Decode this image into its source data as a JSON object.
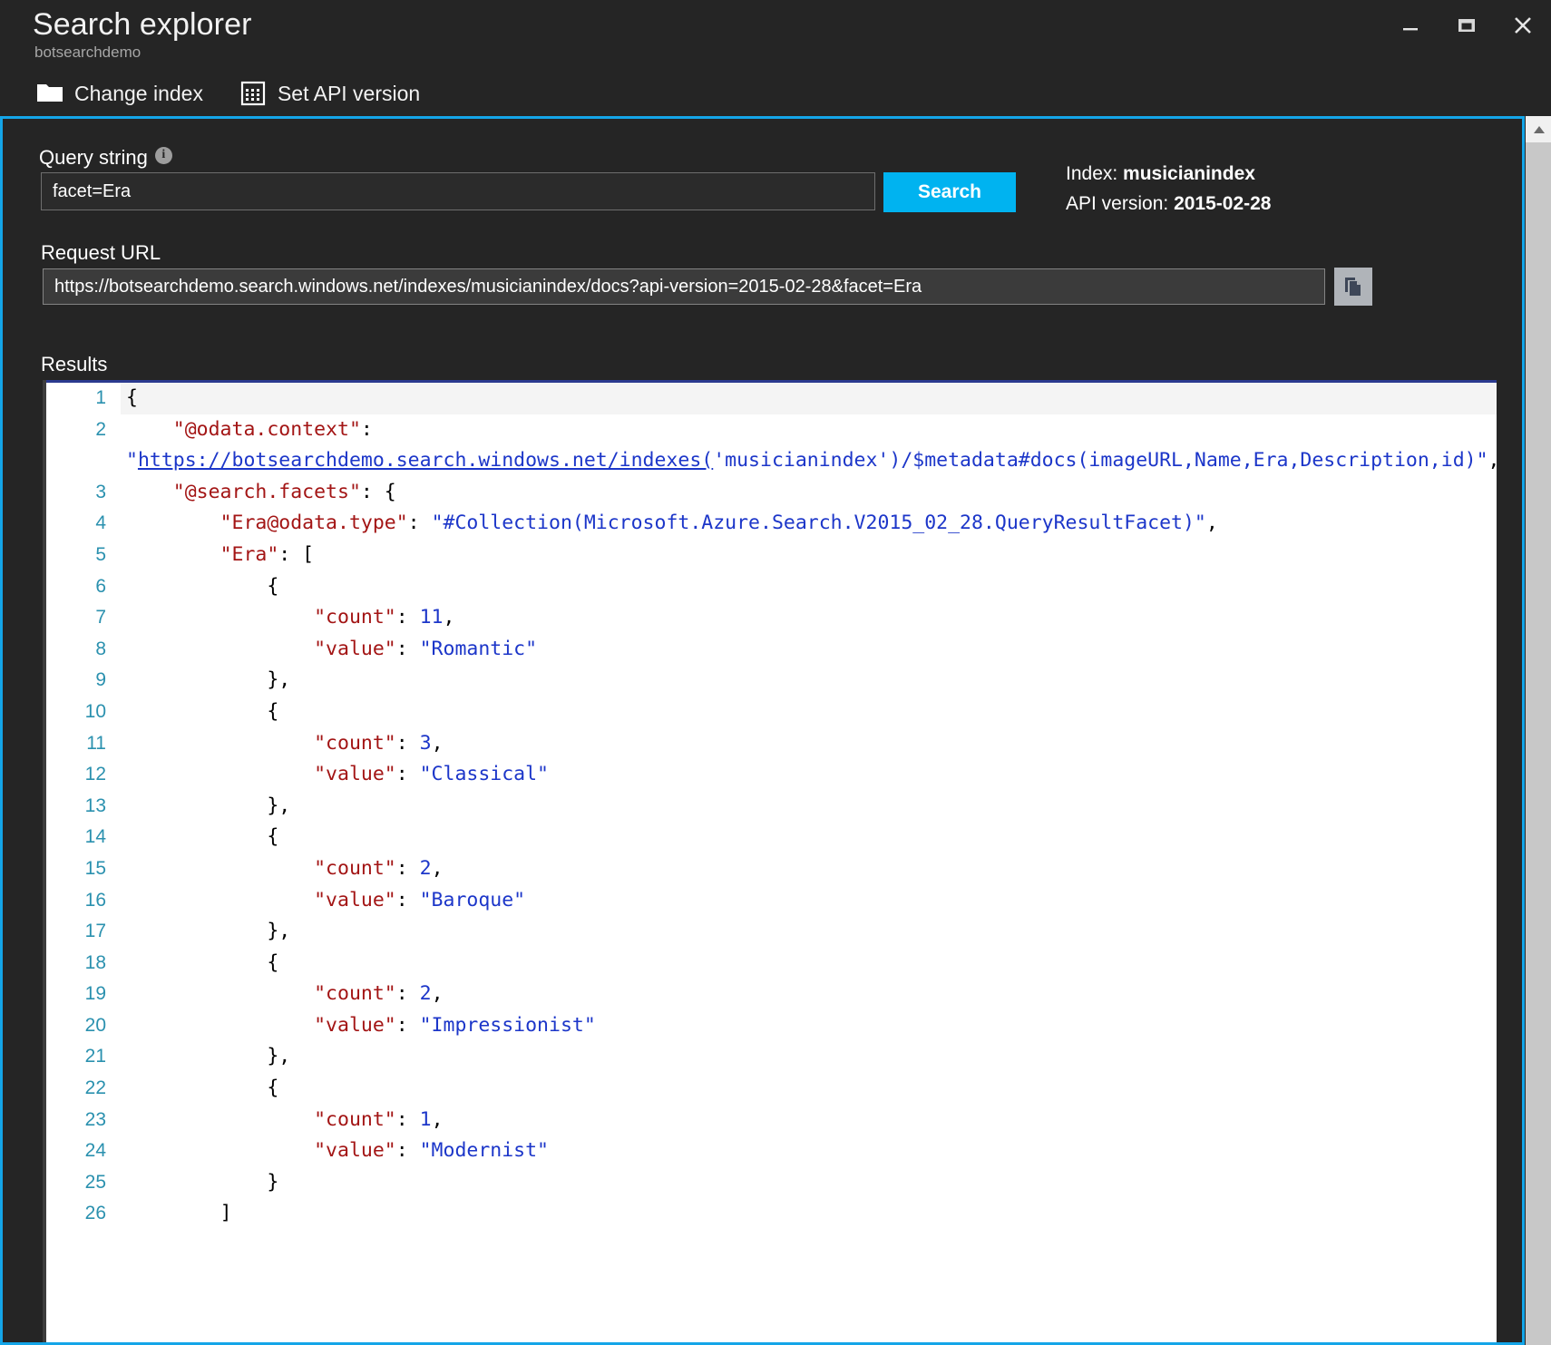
{
  "window": {
    "title": "Search explorer",
    "subtitle": "botsearchdemo",
    "controls": {
      "minimize": "Minimize",
      "maximize": "Maximize",
      "close": "Close"
    }
  },
  "commandbar": {
    "items": [
      {
        "label": "Change index",
        "icon": "folder-icon"
      },
      {
        "label": "Set API version",
        "icon": "grid-calendar-icon"
      }
    ]
  },
  "query": {
    "label": "Query string",
    "info_icon": "info-icon",
    "value": "facet=Era",
    "placeholder": "",
    "search_label": "Search"
  },
  "index_info": {
    "index_label": "Index: ",
    "index_value": "musicianindex",
    "api_label": "API version: ",
    "api_value": "2015-02-28"
  },
  "request": {
    "label": "Request URL",
    "url": "https://botsearchdemo.search.windows.net/indexes/musicianindex/docs?api-version=2015-02-28&facet=Era",
    "copy_icon": "copy-icon"
  },
  "results": {
    "label": "Results",
    "lines": [
      {
        "n": "1",
        "segments": [
          {
            "t": "{",
            "c": "p"
          }
        ]
      },
      {
        "n": "2",
        "segments": [
          {
            "t": "    ",
            "c": "p"
          },
          {
            "t": "\"@odata.context\"",
            "c": "k"
          },
          {
            "t": ": ",
            "c": "p"
          },
          {
            "t": "\"",
            "c": "s"
          },
          {
            "t": "https://botsearchdemo.search.windows.net/indexes(",
            "c": "u"
          },
          {
            "t": "'musicianindex')/$metadata#docs(imageURL,Name,Era,Description,id)\"",
            "c": "s"
          },
          {
            "t": ",",
            "c": "p"
          }
        ]
      },
      {
        "n": "3",
        "segments": [
          {
            "t": "    ",
            "c": "p"
          },
          {
            "t": "\"@search.facets\"",
            "c": "k"
          },
          {
            "t": ": {",
            "c": "p"
          }
        ]
      },
      {
        "n": "4",
        "segments": [
          {
            "t": "        ",
            "c": "p"
          },
          {
            "t": "\"Era@odata.type\"",
            "c": "k"
          },
          {
            "t": ": ",
            "c": "p"
          },
          {
            "t": "\"#Collection(Microsoft.Azure.Search.V2015_02_28.QueryResultFacet)\"",
            "c": "s"
          },
          {
            "t": ",",
            "c": "p"
          }
        ]
      },
      {
        "n": "5",
        "segments": [
          {
            "t": "        ",
            "c": "p"
          },
          {
            "t": "\"Era\"",
            "c": "k"
          },
          {
            "t": ": [",
            "c": "p"
          }
        ]
      },
      {
        "n": "6",
        "segments": [
          {
            "t": "            {",
            "c": "p"
          }
        ]
      },
      {
        "n": "7",
        "segments": [
          {
            "t": "                ",
            "c": "p"
          },
          {
            "t": "\"count\"",
            "c": "k"
          },
          {
            "t": ": ",
            "c": "p"
          },
          {
            "t": "11",
            "c": "s"
          },
          {
            "t": ",",
            "c": "p"
          }
        ]
      },
      {
        "n": "8",
        "segments": [
          {
            "t": "                ",
            "c": "p"
          },
          {
            "t": "\"value\"",
            "c": "k"
          },
          {
            "t": ": ",
            "c": "p"
          },
          {
            "t": "\"Romantic\"",
            "c": "s"
          }
        ]
      },
      {
        "n": "9",
        "segments": [
          {
            "t": "            },",
            "c": "p"
          }
        ]
      },
      {
        "n": "10",
        "segments": [
          {
            "t": "            {",
            "c": "p"
          }
        ]
      },
      {
        "n": "11",
        "segments": [
          {
            "t": "                ",
            "c": "p"
          },
          {
            "t": "\"count\"",
            "c": "k"
          },
          {
            "t": ": ",
            "c": "p"
          },
          {
            "t": "3",
            "c": "s"
          },
          {
            "t": ",",
            "c": "p"
          }
        ]
      },
      {
        "n": "12",
        "segments": [
          {
            "t": "                ",
            "c": "p"
          },
          {
            "t": "\"value\"",
            "c": "k"
          },
          {
            "t": ": ",
            "c": "p"
          },
          {
            "t": "\"Classical\"",
            "c": "s"
          }
        ]
      },
      {
        "n": "13",
        "segments": [
          {
            "t": "            },",
            "c": "p"
          }
        ]
      },
      {
        "n": "14",
        "segments": [
          {
            "t": "            {",
            "c": "p"
          }
        ]
      },
      {
        "n": "15",
        "segments": [
          {
            "t": "                ",
            "c": "p"
          },
          {
            "t": "\"count\"",
            "c": "k"
          },
          {
            "t": ": ",
            "c": "p"
          },
          {
            "t": "2",
            "c": "s"
          },
          {
            "t": ",",
            "c": "p"
          }
        ]
      },
      {
        "n": "16",
        "segments": [
          {
            "t": "                ",
            "c": "p"
          },
          {
            "t": "\"value\"",
            "c": "k"
          },
          {
            "t": ": ",
            "c": "p"
          },
          {
            "t": "\"Baroque\"",
            "c": "s"
          }
        ]
      },
      {
        "n": "17",
        "segments": [
          {
            "t": "            },",
            "c": "p"
          }
        ]
      },
      {
        "n": "18",
        "segments": [
          {
            "t": "            {",
            "c": "p"
          }
        ]
      },
      {
        "n": "19",
        "segments": [
          {
            "t": "                ",
            "c": "p"
          },
          {
            "t": "\"count\"",
            "c": "k"
          },
          {
            "t": ": ",
            "c": "p"
          },
          {
            "t": "2",
            "c": "s"
          },
          {
            "t": ",",
            "c": "p"
          }
        ]
      },
      {
        "n": "20",
        "segments": [
          {
            "t": "                ",
            "c": "p"
          },
          {
            "t": "\"value\"",
            "c": "k"
          },
          {
            "t": ": ",
            "c": "p"
          },
          {
            "t": "\"Impressionist\"",
            "c": "s"
          }
        ]
      },
      {
        "n": "21",
        "segments": [
          {
            "t": "            },",
            "c": "p"
          }
        ]
      },
      {
        "n": "22",
        "segments": [
          {
            "t": "            {",
            "c": "p"
          }
        ]
      },
      {
        "n": "23",
        "segments": [
          {
            "t": "                ",
            "c": "p"
          },
          {
            "t": "\"count\"",
            "c": "k"
          },
          {
            "t": ": ",
            "c": "p"
          },
          {
            "t": "1",
            "c": "s"
          },
          {
            "t": ",",
            "c": "p"
          }
        ]
      },
      {
        "n": "24",
        "segments": [
          {
            "t": "                ",
            "c": "p"
          },
          {
            "t": "\"value\"",
            "c": "k"
          },
          {
            "t": ": ",
            "c": "p"
          },
          {
            "t": "\"Modernist\"",
            "c": "s"
          }
        ]
      },
      {
        "n": "25",
        "segments": [
          {
            "t": "            }",
            "c": "p"
          }
        ]
      },
      {
        "n": "26",
        "segments": [
          {
            "t": "        ]",
            "c": "p"
          }
        ]
      }
    ],
    "facets": {
      "field": "Era",
      "entries": [
        {
          "value": "Romantic",
          "count": 11
        },
        {
          "value": "Classical",
          "count": 3
        },
        {
          "value": "Baroque",
          "count": 2
        },
        {
          "value": "Impressionist",
          "count": 2
        },
        {
          "value": "Modernist",
          "count": 1
        }
      ]
    }
  },
  "colors": {
    "accent": "#00b3f0",
    "pane_border": "#14a5e8",
    "json_key": "#a31515",
    "json_value": "#1c36c9",
    "line_number": "#2b91af",
    "window_bg": "#252525"
  }
}
